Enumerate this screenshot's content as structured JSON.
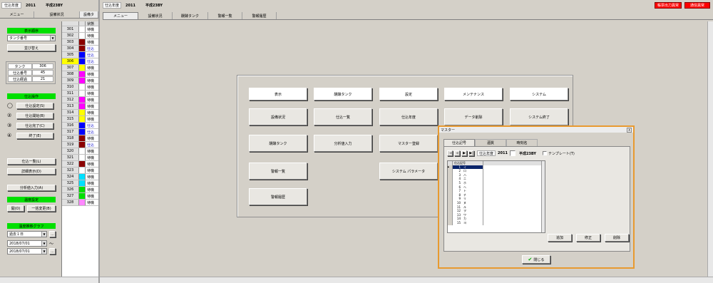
{
  "left_top": {
    "label": "仕込年度",
    "year": "2011",
    "reiwa": "平成23BY"
  },
  "right_top": {
    "label": "仕込年度",
    "year": "2011",
    "reiwa": "平成23BY"
  },
  "alerts": [
    "帳票出力異常",
    "通信異常"
  ],
  "left_tabs": [
    "メニュー",
    "設備状況",
    "設備タ"
  ],
  "main_tabs": [
    "メニュー",
    "設備状況",
    "醗酵タンク",
    "警報一覧",
    "警報履歴"
  ],
  "sidebar": {
    "display_order_header": "表示順序",
    "display_order_value": "タンク番号",
    "sort_button": "並び替え",
    "tank_label": "タンク",
    "tank_value": "306",
    "brew_no_label": "仕込番号",
    "brew_no_value": "45",
    "brew_days_label": "仕込経過",
    "brew_days_value": "21",
    "ops_header": "仕込操作",
    "ops": [
      {
        "num": "◯",
        "label": "仕込設定(S)"
      },
      {
        "num": "②",
        "label": "仕込開始(B)"
      },
      {
        "num": "③",
        "label": "仕込完了(C)"
      },
      {
        "num": "④",
        "label": "終了(E)"
      }
    ],
    "list_button": "仕込一覧(L)",
    "detail_button": "詳細表示(D)",
    "analysis_button": "分析値入力(A)",
    "temp_header": "温度設定",
    "open_button": "開(O)",
    "bulk_button": "一括変更(B)",
    "graph_header": "温度推移グラフ",
    "period": "過去１日",
    "date_from": "2018/07/01",
    "date_to": "2018/07/01",
    "tilde": "〜",
    "ellipsis": "..."
  },
  "tank_list_header": "状態",
  "tank_list": [
    {
      "no": "301",
      "color": "#ffffff",
      "status": "待機"
    },
    {
      "no": "302",
      "color": "#ffffff",
      "status": "待機"
    },
    {
      "no": "303",
      "color": "#8b0000",
      "status": "待機"
    },
    {
      "no": "304",
      "color": "#8b0000",
      "status": "仕込"
    },
    {
      "no": "305",
      "color": "#0000ff",
      "status": "仕込"
    },
    {
      "no": "306",
      "color": "#0000ff",
      "status": "仕込"
    },
    {
      "no": "307",
      "color": "#ffff00",
      "status": "待機"
    },
    {
      "no": "308",
      "color": "#ff00ff",
      "status": "待機"
    },
    {
      "no": "309",
      "color": "#ff00ff",
      "status": "待機"
    },
    {
      "no": "310",
      "color": "#ffffff",
      "status": "待機"
    },
    {
      "no": "311",
      "color": "#ffffff",
      "status": "待機"
    },
    {
      "no": "312",
      "color": "#ff00ff",
      "status": "待機"
    },
    {
      "no": "313",
      "color": "#ff00ff",
      "status": "待機"
    },
    {
      "no": "314",
      "color": "#ffff00",
      "status": "待機"
    },
    {
      "no": "315",
      "color": "#ffff00",
      "status": "待機"
    },
    {
      "no": "316",
      "color": "#0000ff",
      "status": "仕込"
    },
    {
      "no": "317",
      "color": "#0000ff",
      "status": "仕込"
    },
    {
      "no": "318",
      "color": "#8b0000",
      "status": "待機"
    },
    {
      "no": "319",
      "color": "#8b0000",
      "status": "仕込"
    },
    {
      "no": "320",
      "color": "#ffffff",
      "status": "待機"
    },
    {
      "no": "321",
      "color": "#ffffff",
      "status": "待機"
    },
    {
      "no": "322",
      "color": "#8b0000",
      "status": "待機"
    },
    {
      "no": "323",
      "color": "#ffffff",
      "status": "待機"
    },
    {
      "no": "324",
      "color": "#00e0ff",
      "status": "待機"
    },
    {
      "no": "325",
      "color": "#00e0ff",
      "status": "待機"
    },
    {
      "no": "326",
      "color": "#00e000",
      "status": "待機"
    },
    {
      "no": "327",
      "color": "#00e000",
      "status": "待機"
    },
    {
      "no": "328",
      "color": "#ff88ff",
      "status": "待機"
    }
  ],
  "menu": {
    "headers": [
      "表示",
      "醗酵タンク",
      "設定",
      "メンテナンス",
      "システム"
    ],
    "buttons": [
      "設備状況",
      "仕込一覧",
      "仕込年度",
      "データ削除",
      "システム終了",
      "醗酵タンク",
      "分析値入力",
      "マスター登録",
      "システム パラメータ",
      "警報一覧",
      "警報履歴"
    ]
  },
  "dialog": {
    "title": "マスター",
    "close": "X",
    "tabs": [
      "仕込記号",
      "酒質",
      "時刻名"
    ],
    "year_label": "仕込年度",
    "year": "2011",
    "reiwa": "平成23BY",
    "template": "テンプレート(T)",
    "grid_header": "仕込記号",
    "rows": [
      {
        "n": "1",
        "v": "イ"
      },
      {
        "n": "2",
        "v": "ロ"
      },
      {
        "n": "3",
        "v": "ハ"
      },
      {
        "n": "4",
        "v": "ニ"
      },
      {
        "n": "5",
        "v": "ホ"
      },
      {
        "n": "6",
        "v": "ヘ"
      },
      {
        "n": "7",
        "v": "ト"
      },
      {
        "n": "8",
        "v": "チ"
      },
      {
        "n": "9",
        "v": "リ"
      },
      {
        "n": "10",
        "v": "ヌ"
      },
      {
        "n": "11",
        "v": "ル"
      },
      {
        "n": "12",
        "v": "ヲ"
      },
      {
        "n": "13",
        "v": "ワ"
      },
      {
        "n": "14",
        "v": "カ"
      },
      {
        "n": "15",
        "v": "ヨ"
      }
    ],
    "add_button": "追加",
    "edit_button": "修正",
    "delete_button": "削除",
    "ok_button": "閉じる"
  }
}
